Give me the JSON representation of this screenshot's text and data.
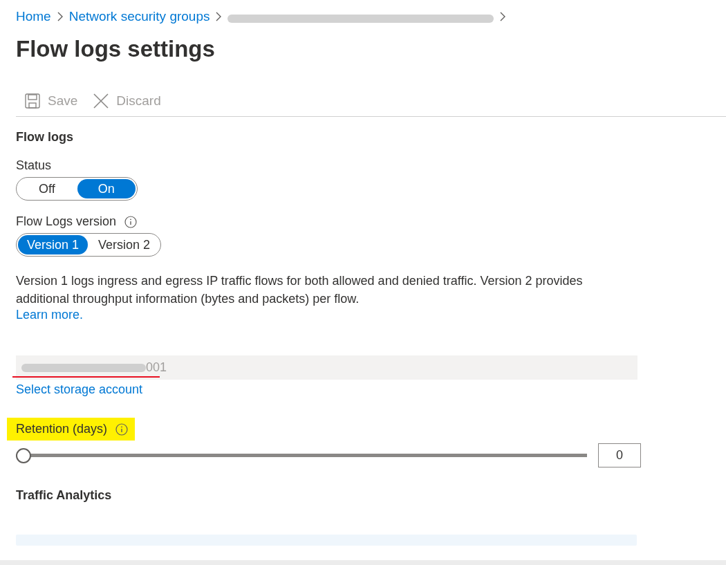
{
  "breadcrumb": [
    {
      "label": "Home",
      "kind": "link"
    },
    {
      "label": "Network security groups",
      "kind": "link"
    },
    {
      "kind": "redacted"
    }
  ],
  "title": "Flow logs settings",
  "toolbar": [
    {
      "label": "Save",
      "kind": "save",
      "disabled": true
    },
    {
      "label": "Discard",
      "kind": "discard",
      "disabled": true
    }
  ],
  "section_title": "Flow logs",
  "status": {
    "label": "Status",
    "options": [
      {
        "label": "Off",
        "selected": false
      },
      {
        "label": "On",
        "selected": true
      }
    ]
  },
  "version": {
    "label": "Flow Logs version",
    "options": [
      {
        "label": "Version 1",
        "selected": true
      },
      {
        "label": "Version 2",
        "selected": false
      }
    ]
  },
  "description": "Version 1 logs ingress and egress IP traffic flows for both allowed and denied traffic. Version 2 provides additional throughput information (bytes and packets) per flow.",
  "learn_more": "Learn more.",
  "storage": {
    "value": "001",
    "redacted": true,
    "underlined": true
  },
  "select_storage": "Select storage account",
  "retention": {
    "label": "Retention (days)",
    "highlighted": true,
    "level": 0,
    "value": "0"
  },
  "traffic_title": "Traffic Analytics"
}
